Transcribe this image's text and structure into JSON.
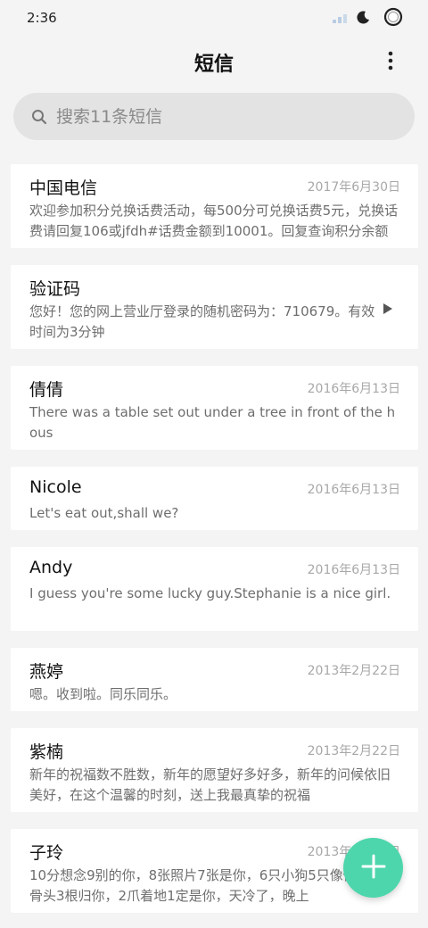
{
  "status": {
    "time": "2:36"
  },
  "header": {
    "title": "短信"
  },
  "search": {
    "placeholder": "搜索11条短信"
  },
  "messages": [
    {
      "name": "中国电信",
      "date": "2017年6月30日",
      "preview": "欢迎参加积分兑换话费活动，每500分可兑换话费5元，兑换话费请回复106或jfdh#话费金额到10001。回复查询积分余额"
    },
    {
      "name": "验证码",
      "date": "",
      "preview": "您好！您的网上营业厅登录的随机密码为：710679。有效时间为3分钟",
      "icon": "play-icon"
    },
    {
      "name": "倩倩",
      "date": "2016年6月13日",
      "preview": "There was a table set out under a tree in front of the hous"
    },
    {
      "name": "Nicole",
      "date": "2016年6月13日",
      "preview": "Let's eat out,shall we?"
    },
    {
      "name": "Andy",
      "date": "2016年6月13日",
      "preview": "I guess you're some lucky guy.Stephanie is a nice girl."
    },
    {
      "name": "燕婷",
      "date": "2013年2月22日",
      "preview": "嗯。收到啦。同乐同乐。"
    },
    {
      "name": "紫楠",
      "date": "2013年2月22日",
      "preview": "新年的祝福数不胜数，新年的愿望好多好多，新年的问候依旧美好，在这个温馨的时刻，送上我最真挚的祝福"
    },
    {
      "name": "子玲",
      "date": "2013年2月22日",
      "preview": "10分想念9别的你，8张照片7张是你，6只小狗5只像你，4根骨头3根归你，2爪着地1定是你，天冷了，晚上"
    }
  ],
  "fab": {
    "icon": "plus-icon"
  },
  "colors": {
    "accent": "#4dd6ac",
    "background": "#f4f4f4",
    "card": "#ffffff",
    "search": "#e3e3e3"
  }
}
